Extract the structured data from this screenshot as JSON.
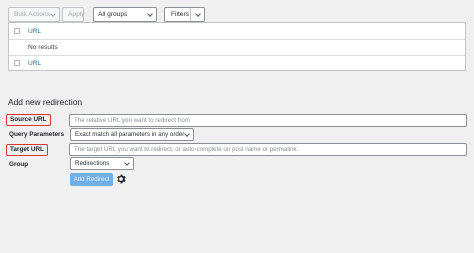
{
  "toolbar": {
    "bulk_actions": "Bulk Actions",
    "apply": "Apply",
    "groups_select": "All groups",
    "filters": "Filters"
  },
  "table": {
    "header_url": "URL",
    "empty_message": "No results",
    "footer_url": "URL"
  },
  "form": {
    "heading": "Add new redirection",
    "source_url_label": "Source URL",
    "source_url_placeholder": "The relative URL you want to redirect from",
    "query_params_label": "Query Parameters",
    "query_params_value": "Exact match all parameters in any order",
    "target_url_label": "Target URL",
    "target_url_placeholder": "The target URL you want to redirect, or auto-complete on post name or permalink.",
    "group_label": "Group",
    "group_value": "Redirections",
    "add_redirect_button": "Add Redirect"
  },
  "icons": {
    "settings": "gear-icon"
  },
  "colors": {
    "highlight_border": "#d63638",
    "link": "#2271b1",
    "primary_button": "#72aee6"
  }
}
